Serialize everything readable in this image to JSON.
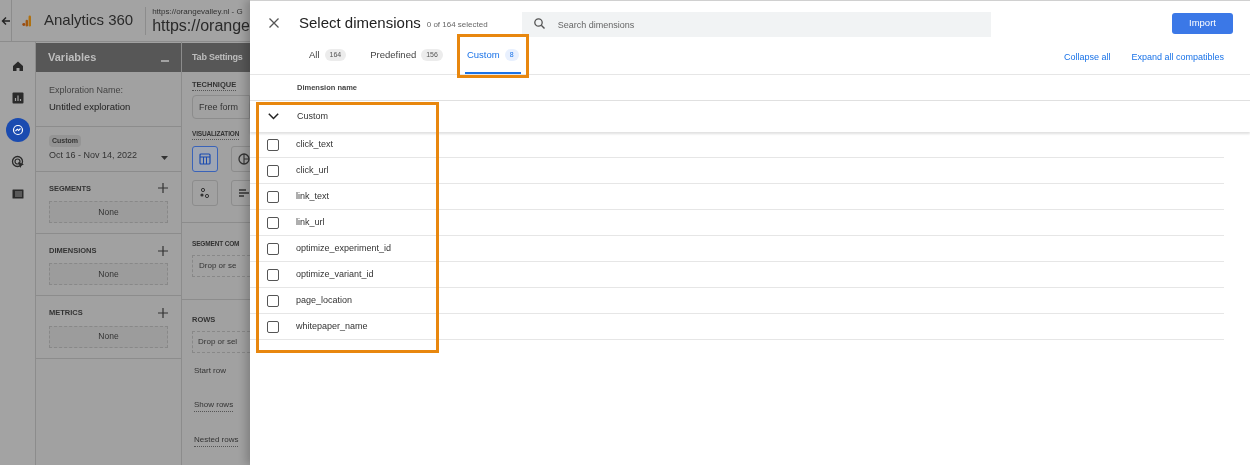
{
  "app": {
    "title": "Analytics 360",
    "url_small": "https://orangevalley.nl - G",
    "url_large": "https://orange",
    "rail": [
      {
        "selected": false
      },
      {
        "selected": false
      },
      {
        "selected": true
      },
      {
        "selected": false
      },
      {
        "selected": false
      }
    ]
  },
  "variables": {
    "title": "Variables",
    "name_label": "Exploration Name:",
    "name_value": "Untitled exploration",
    "date_tag": "Custom",
    "date_range": "Oct 16 - Nov 14, 2022",
    "sections": [
      {
        "label": "SEGMENTS",
        "value": "None"
      },
      {
        "label": "DIMENSIONS",
        "value": "None"
      },
      {
        "label": "METRICS",
        "value": "None"
      }
    ]
  },
  "tab_settings": {
    "title": "Tab Settings",
    "technique_label": "TECHNIQUE",
    "technique_value": "Free form",
    "visualization_label": "VISUALIZATION",
    "visualizations": [
      {
        "selected": true
      },
      {
        "selected": false
      },
      {
        "selected": false
      },
      {
        "selected": false
      }
    ],
    "segment_label": "SEGMENT COM",
    "segment_drop": "Drop or se",
    "rows_label": "ROWS",
    "rows_drop": "Drop or sel",
    "options": [
      "Start row",
      "Show rows",
      "Nested rows"
    ]
  },
  "dialog": {
    "title": "Select dimensions",
    "count": "0 of 164 selected",
    "search": {
      "placeholder": "Search dimensions"
    },
    "import_button": "Import",
    "tabs": [
      {
        "label": "All",
        "count": "164",
        "selected": false,
        "highlighted": false
      },
      {
        "label": "Predefined",
        "count": "156",
        "selected": false,
        "highlighted": false
      },
      {
        "label": "Custom",
        "count": "8",
        "selected": true,
        "highlighted": true
      }
    ],
    "collapse_all": "Collapse all",
    "expand_all": "Expand all compatibles",
    "column_header": "Dimension name",
    "group": {
      "label": "Custom",
      "expanded": true,
      "highlighted": true,
      "items": [
        {
          "name": "click_text",
          "checked": false
        },
        {
          "name": "click_url",
          "checked": false
        },
        {
          "name": "link_text",
          "checked": false
        },
        {
          "name": "link_url",
          "checked": false
        },
        {
          "name": "optimize_experiment_id",
          "checked": false
        },
        {
          "name": "optimize_variant_id",
          "checked": false
        },
        {
          "name": "page_location",
          "checked": false
        },
        {
          "name": "whitepaper_name",
          "checked": false
        }
      ]
    }
  }
}
